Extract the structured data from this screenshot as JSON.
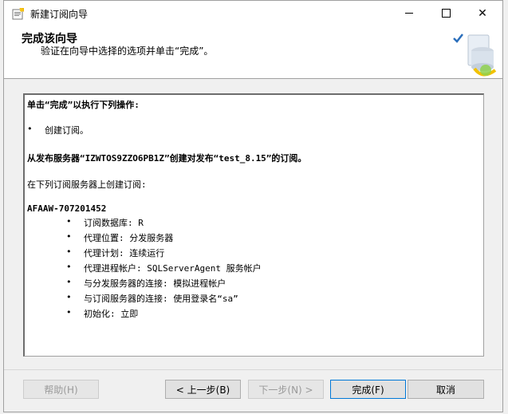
{
  "window": {
    "title": "新建订阅向导"
  },
  "header": {
    "title": "完成该向导",
    "subtitle": "验证在向导中选择的选项并单击“完成”。"
  },
  "content": {
    "intro": "单击“完成”以执行下列操作:",
    "action_item": "创建订阅。",
    "publisher_line": "从发布服务器“IZWTOS9ZZO6PB1Z”创建对发布“test_8.15”的订阅。",
    "subscriber_intro": "在下列订阅服务器上创建订阅:",
    "subscriber_name": "AFAAW-707201452",
    "details": [
      "订阅数据库: R",
      "代理位置: 分发服务器",
      "代理计划: 连续运行",
      "代理进程帐户: SQLServerAgent 服务帐户",
      "与分发服务器的连接: 模拟进程帐户",
      "与订阅服务器的连接: 使用登录名“sa”",
      "初始化: 立即"
    ]
  },
  "buttons": {
    "help": "帮助(H)",
    "back": "< 上一步(B)",
    "next": "下一步(N) >",
    "finish": "完成(F)",
    "cancel": "取消"
  },
  "icons": {
    "close": "✕",
    "bullet": "•"
  },
  "colors": {
    "accent": "#0078d7",
    "disabled_text": "#9a9a9a"
  }
}
